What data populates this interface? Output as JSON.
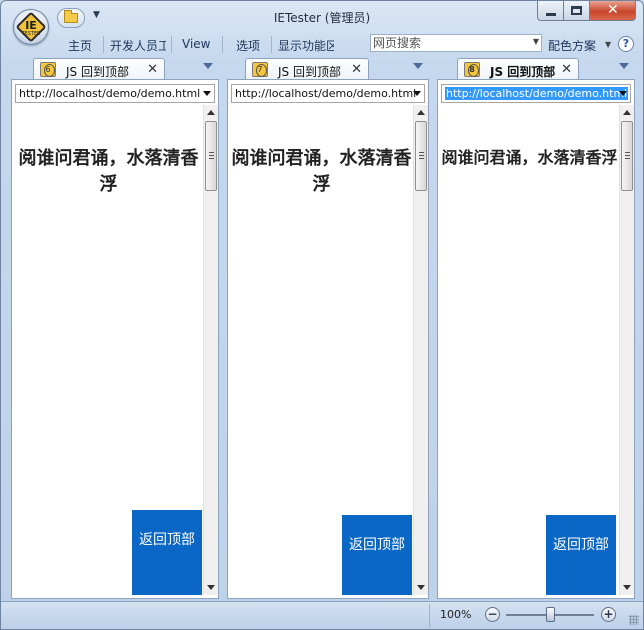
{
  "window": {
    "title": "IETester (管理员)"
  },
  "app_logo": {
    "main": "IE",
    "sub": "TESTER"
  },
  "menu": {
    "items": [
      "主页",
      "开发人员工",
      "View",
      "选项",
      "显示功能区"
    ],
    "search_placeholder": "网页搜索",
    "color_scheme_label": "配色方案",
    "help_label": "?"
  },
  "panes": [
    {
      "badge": "6",
      "tab_label": "JS 回到顶部",
      "url": "http://localhost/demo/demo.html",
      "url_selected": false,
      "heading": "阅谁问君诵，水落清香浮",
      "back_top_label": "返回顶部"
    },
    {
      "badge": "7",
      "tab_label": "JS 回到顶部",
      "url": "http://localhost/demo/demo.html",
      "url_selected": false,
      "heading": "阅谁问君诵，水落清香浮",
      "back_top_label": "返回顶部"
    },
    {
      "badge": "8",
      "tab_label": "JS 回到顶部",
      "url": "http://localhost/demo/demo.html",
      "url_selected": true,
      "heading": "阅谁问君诵，水落清香浮",
      "back_top_label": "返回顶部"
    }
  ],
  "status": {
    "zoom_level": "100%"
  },
  "colors": {
    "back_top_button": "#0a67c5",
    "url_selection": "#3399ff",
    "window_chrome": "#c9d9ec"
  }
}
